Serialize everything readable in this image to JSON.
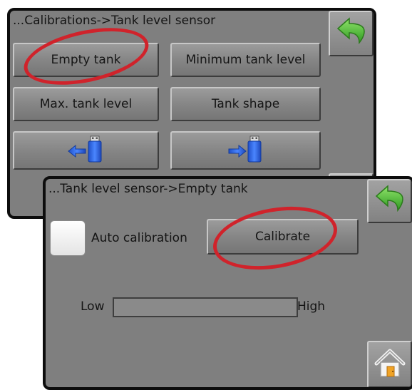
{
  "panel1": {
    "title": "...Calibrations->Tank level sensor",
    "buttons": {
      "empty_tank": "Empty tank",
      "min_level": "Minimum tank level",
      "max_level": "Max. tank level",
      "tank_shape": "Tank shape"
    },
    "icons": {
      "back": "back-arrow-icon",
      "import": "usb-import-icon",
      "export": "usb-export-icon"
    }
  },
  "panel2": {
    "title": "...Tank level sensor->Empty tank",
    "auto_calibration_label": "Auto calibration",
    "auto_calibration_checked": false,
    "calibrate_label": "Calibrate",
    "low_label": "Low",
    "high_label": "High",
    "level_fraction": 0,
    "icons": {
      "back": "back-arrow-icon",
      "home": "home-icon"
    }
  },
  "colors": {
    "panel_bg": "#7f7f7f",
    "highlight_ring": "#d0232b",
    "arrow_green": "#52b83a",
    "usb_blue": "#2a61d8"
  }
}
